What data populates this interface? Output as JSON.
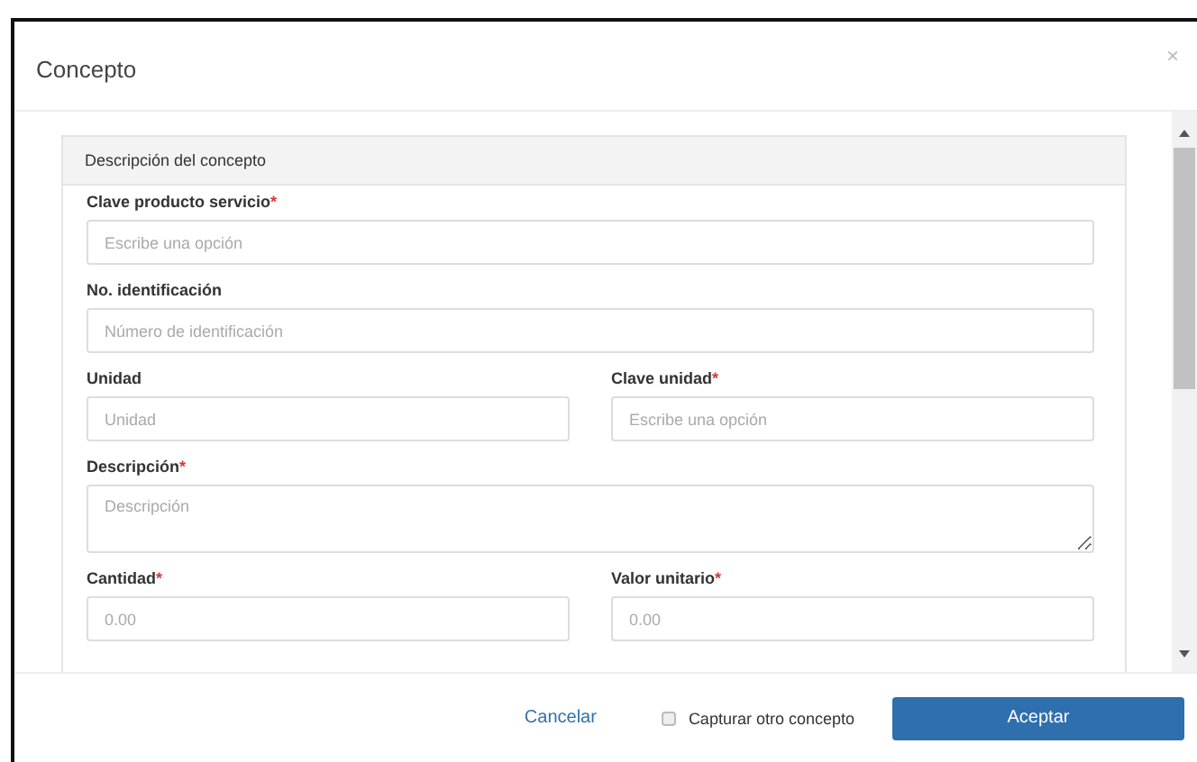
{
  "dialog": {
    "title": "Concepto",
    "close": "×"
  },
  "section": {
    "title": "Descripción del concepto"
  },
  "rows": [
    {
      "fields": [
        {
          "kind": "input",
          "label": "Clave producto servicio",
          "required_mark": "*",
          "placeholder": "Escribe una opción"
        }
      ]
    },
    {
      "fields": [
        {
          "kind": "input",
          "label": "No. identificación",
          "placeholder": "Número de identificación"
        }
      ]
    },
    {
      "fields": [
        {
          "kind": "input",
          "label": "Unidad",
          "placeholder": "Unidad"
        },
        {
          "kind": "input",
          "label": "Clave unidad",
          "required_mark": "*",
          "placeholder": "Escribe una opción"
        }
      ]
    },
    {
      "fields": [
        {
          "kind": "textarea",
          "label": "Descripción",
          "required_mark": "*",
          "placeholder": "Descripción"
        }
      ]
    },
    {
      "fields": [
        {
          "kind": "input",
          "label": "Cantidad",
          "required_mark": "*",
          "placeholder": "0.00"
        },
        {
          "kind": "input",
          "label": "Valor unitario",
          "required_mark": "*",
          "placeholder": "0.00"
        }
      ]
    }
  ],
  "footer": {
    "cancel": "Cancelar",
    "checkbox": {
      "label": "Capturar otro concepto",
      "checked": false
    },
    "accept": "Aceptar"
  }
}
